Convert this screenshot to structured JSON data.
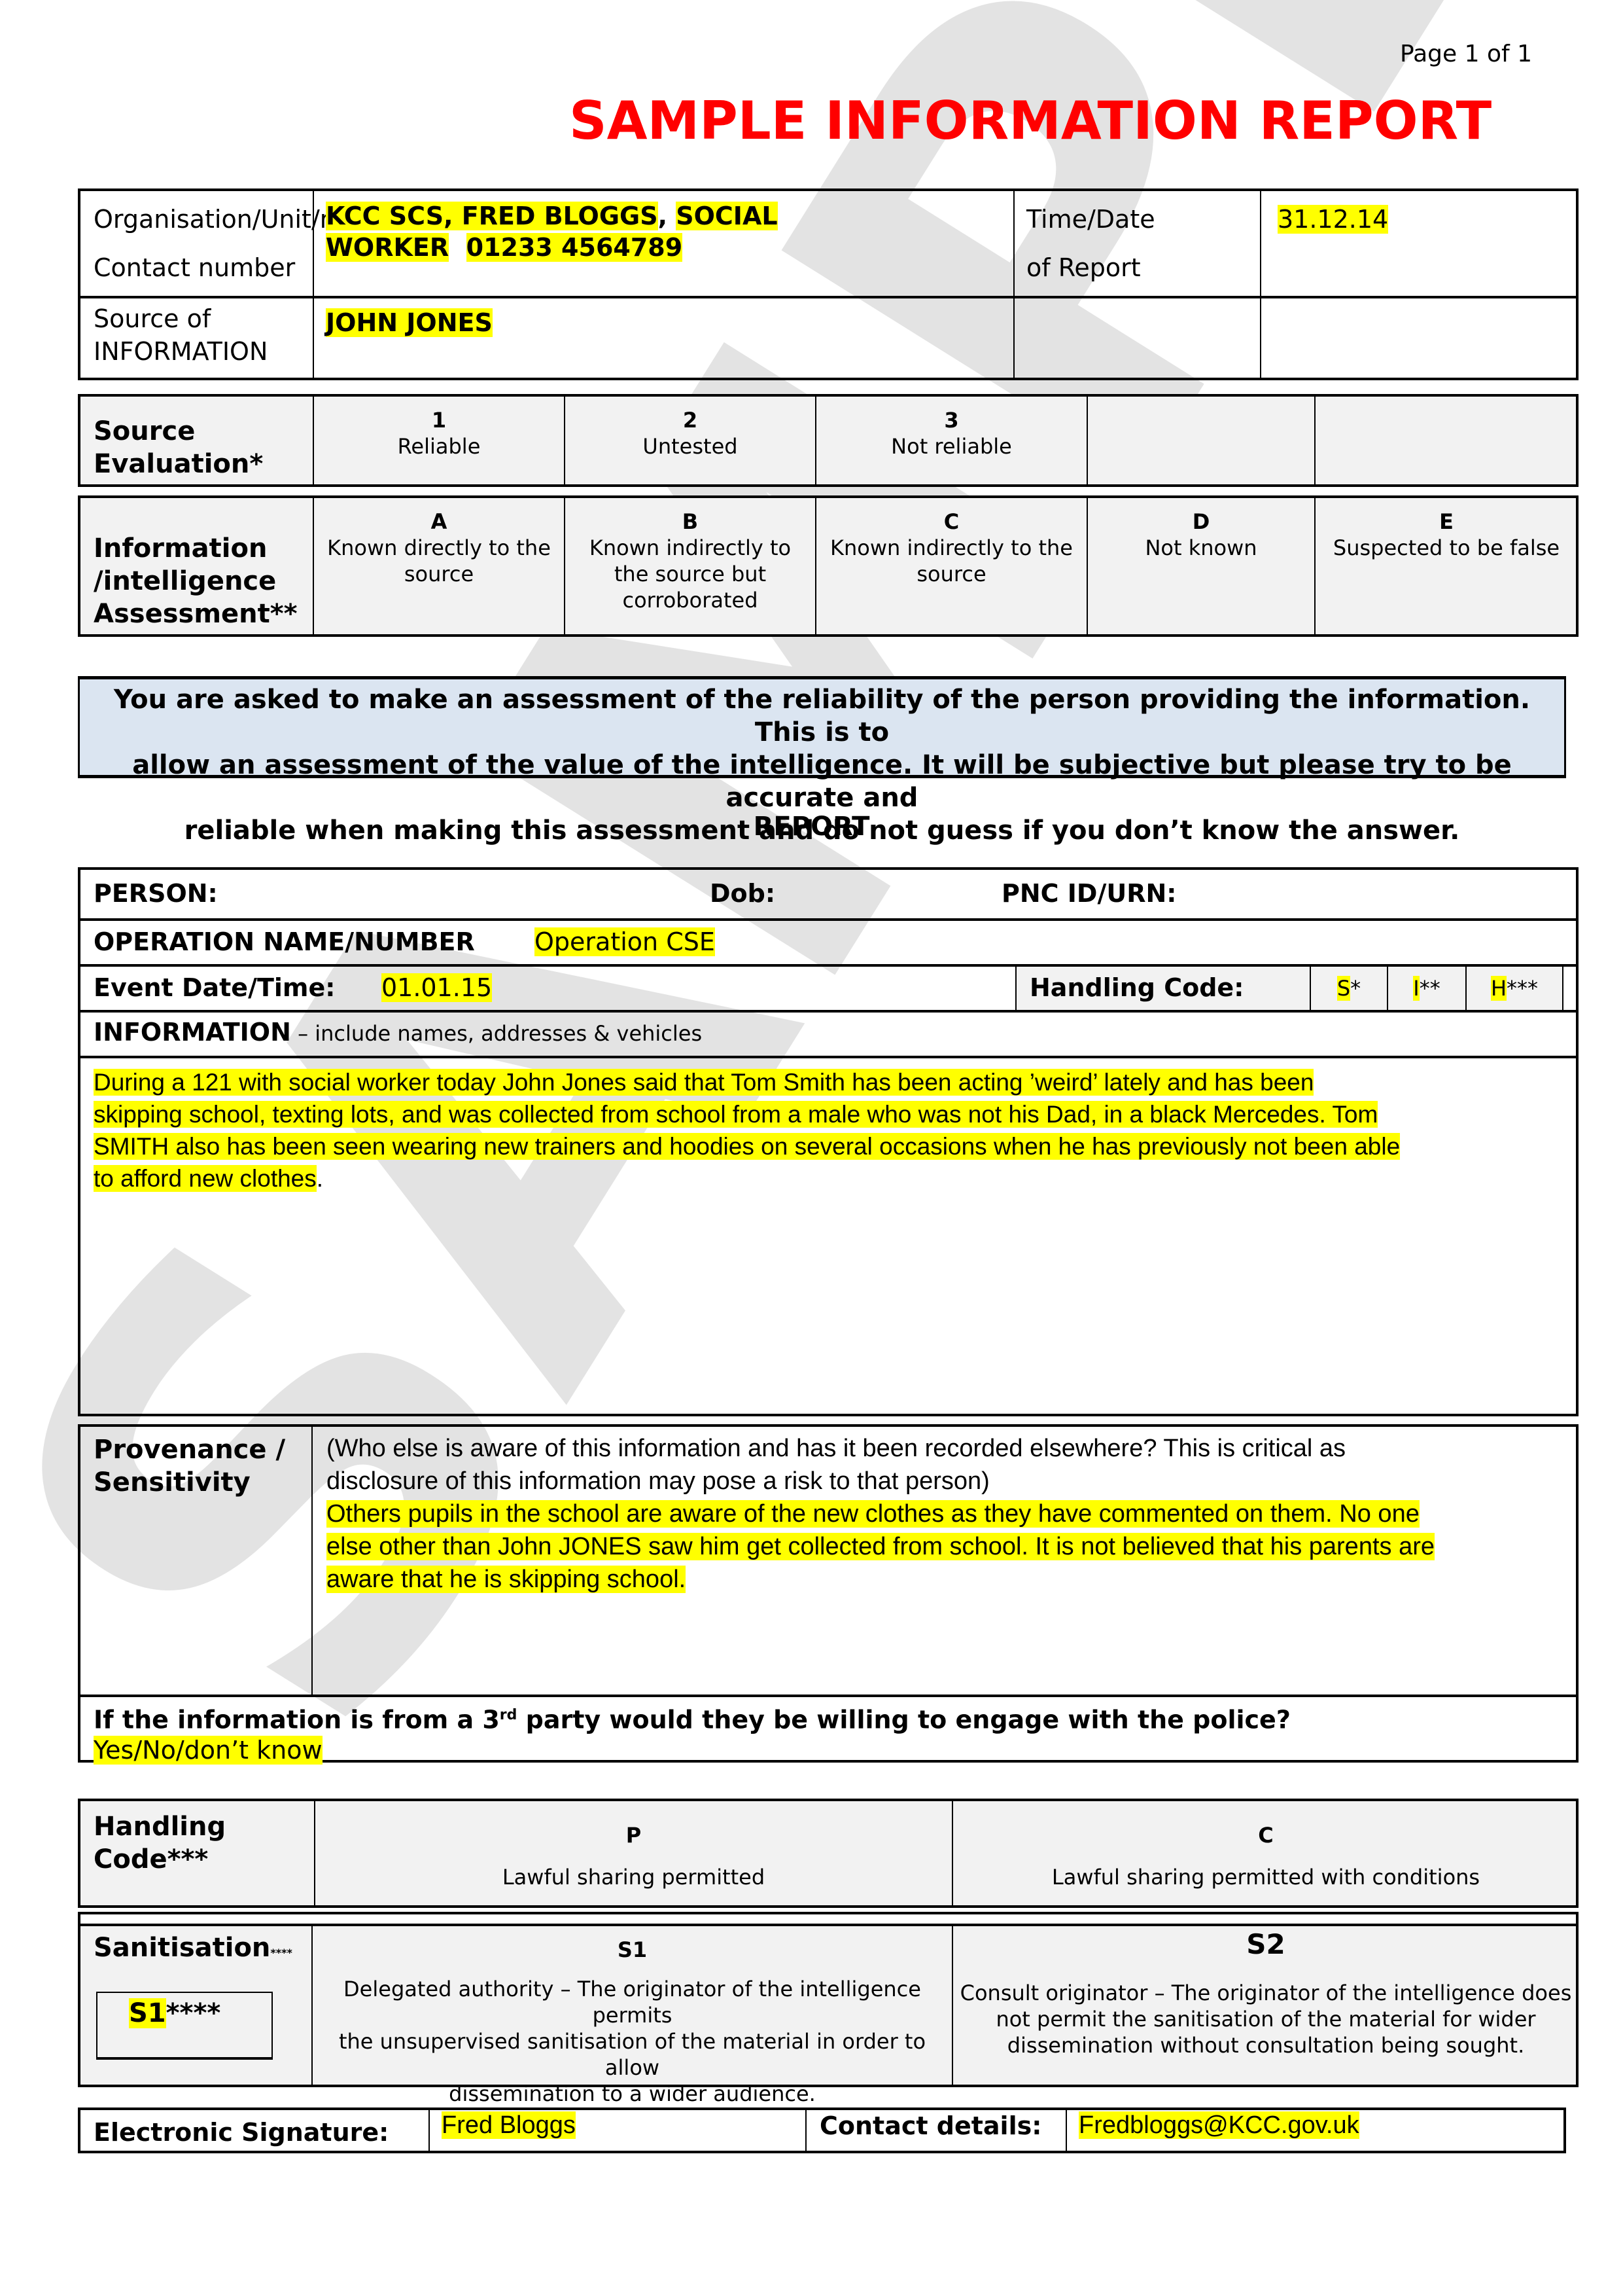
{
  "page_indicator": "Page 1 of 1",
  "title": "SAMPLE INFORMATION REPORT",
  "watermark": "SAMPLE",
  "header_table": {
    "org_label_line1": "Organisation/Unit/role/",
    "org_label_line2": "Contact number",
    "org_value_line1a": "KCC SCS, FRED BLOGGS",
    "org_value_line1b": ", ",
    "org_value_line1c": "SOCIAL",
    "org_value_line2a": "WORKER",
    "org_value_line2b": "01233 4564789",
    "time_label_line1": "Time/Date",
    "time_label_line2": "of Report",
    "time_value": "31.12.14",
    "source_label_line1": "Source of",
    "source_label_line2": "INFORMATION",
    "source_value": "JOHN JONES"
  },
  "source_evaluation": {
    "label_line1": "Source",
    "label_line2": "Evaluation*",
    "options": [
      {
        "code": "1",
        "text": "Reliable"
      },
      {
        "code": "2",
        "text": "Untested"
      },
      {
        "code": "3",
        "text": "Not reliable"
      }
    ]
  },
  "info_assessment": {
    "label_line1": "Information",
    "label_line2": "/intelligence",
    "label_line3": "Assessment**",
    "options": [
      {
        "code": "A",
        "line1": "Known directly to the",
        "line2": "source",
        "line3": ""
      },
      {
        "code": "B",
        "line1": "Known indirectly to",
        "line2": "the source but",
        "line3": "corroborated"
      },
      {
        "code": "C",
        "line1": "Known indirectly to the",
        "line2": "source",
        "line3": ""
      },
      {
        "code": "D",
        "line1": "Not known",
        "line2": "",
        "line3": ""
      },
      {
        "code": "E",
        "line1": "Suspected to be false",
        "line2": "",
        "line3": ""
      }
    ]
  },
  "notice": {
    "line1": "You are asked to make an assessment of the reliability of the person providing the information. This is to",
    "line2": "allow an assessment of the value of the intelligence. It will be subjective but please try to be accurate and",
    "line3": "reliable when making this assessment and do not guess if you don’t know the answer."
  },
  "report": {
    "heading": "REPORT",
    "person_label": "PERSON:",
    "dob_label": "Dob:",
    "pnc_label": "PNC ID/URN:",
    "operation_label": "OPERATION NAME/NUMBER",
    "operation_value": "Operation CSE",
    "event_label": "Event Date/Time:",
    "event_value": "01.01.15",
    "handling_label": "Handling Code:",
    "handling_codes": [
      {
        "letter": "S",
        "stars": "*"
      },
      {
        "letter": "I",
        "stars": "**"
      },
      {
        "letter": "H",
        "stars": "***"
      }
    ],
    "information_label": "INFORMATION",
    "information_hint": " – include names, addresses & vehicles",
    "information_lines": [
      "During a 121 with social worker today John Jones said that Tom Smith has been acting ’weird’ lately and has been",
      "skipping school, texting lots, and was collected from school from a male who was not his Dad, in a black Mercedes. Tom",
      "SMITH also has been seen wearing new trainers and hoodies on several occasions when he has previously not been able",
      "to afford new clothes"
    ],
    "information_trailing": ".",
    "provenance_label_line1": "Provenance /",
    "provenance_label_line2": "Sensitivity",
    "provenance_prompt_line1": "(Who else is aware of this information and has it been recorded elsewhere? This is critical as",
    "provenance_prompt_line2": "disclosure of this information may pose a risk to that person)",
    "provenance_lines": [
      "Others pupils in the school are aware of the new clothes as they have commented on them. No one",
      "else other than John JONES saw him get collected from school. It is not believed that his parents are",
      "aware that he is skipping school."
    ],
    "third_party_q_a": "If the information is from a 3",
    "third_party_q_sup": "rd",
    "third_party_q_b": " party would they be willing to engage with the police?",
    "third_party_answer": "Yes/No/don’t know"
  },
  "handling_code_table": {
    "label_line1": "Handling",
    "label_line2": "Code***",
    "options": [
      {
        "code": "P",
        "text": "Lawful sharing permitted"
      },
      {
        "code": "C",
        "text": "Lawful sharing permitted with conditions"
      }
    ]
  },
  "sanitisation": {
    "label": "Sanitisation",
    "label_suffix": "****",
    "selected_code": "S1",
    "selected_suffix": "****",
    "options": [
      {
        "code": "S1",
        "line1": "Delegated authority – The originator of the intelligence permits",
        "line2": "the unsupervised sanitisation of the material in order to allow",
        "line3": "dissemination to a wider audience."
      },
      {
        "code": "S2",
        "line1": "Consult originator – The originator of the intelligence does",
        "line2": "not permit the sanitisation of the material for wider",
        "line3": "dissemination without consultation being sought."
      }
    ]
  },
  "signature": {
    "label": "Electronic Signature:",
    "value": "Fred Bloggs",
    "contact_label": "Contact details:",
    "contact_value": "Fredbloggs@KCC.gov.uk"
  },
  "colors": {
    "title_red": "#ff0000",
    "highlight": "#ffff00",
    "notice_blue": "#dbe5f1",
    "cell_gray": "#f2f2f2",
    "watermark_gray": "#e3e3e3"
  }
}
